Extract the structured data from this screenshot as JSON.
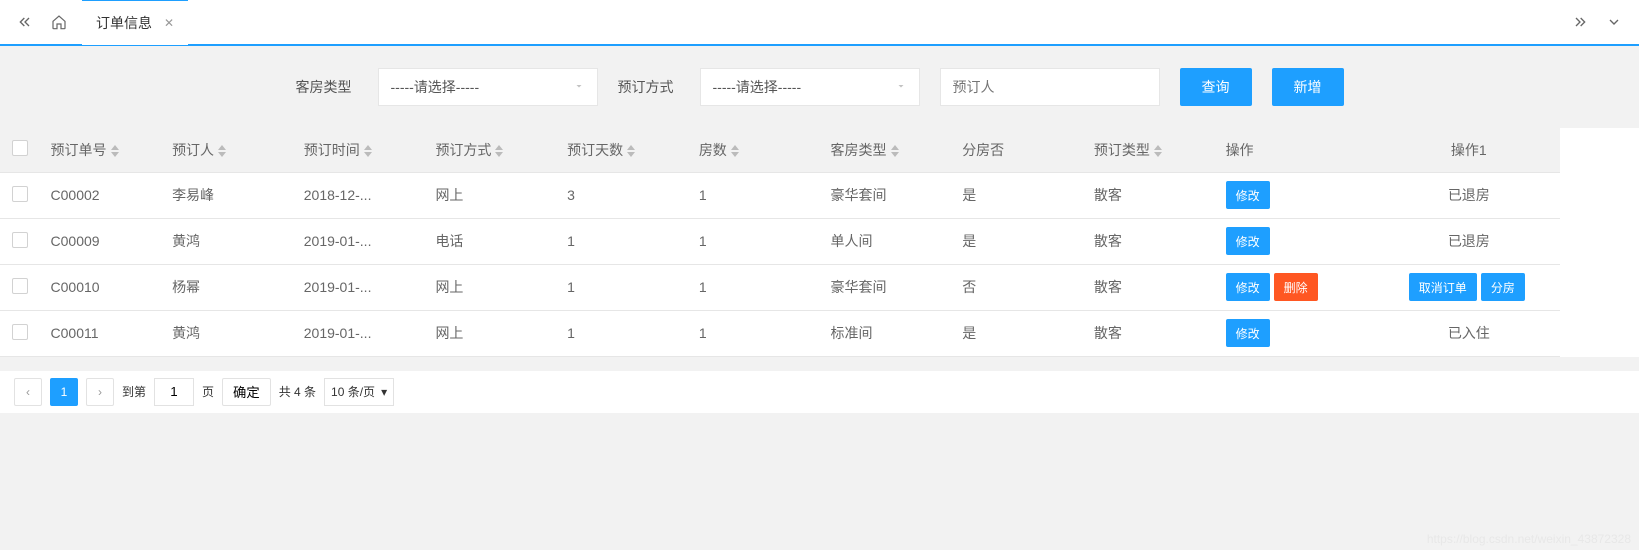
{
  "tab": {
    "title": "订单信息"
  },
  "filters": {
    "room_type_label": "客房类型",
    "room_type_placeholder": "-----请选择-----",
    "method_label": "预订方式",
    "method_placeholder": "-----请选择-----",
    "booker_placeholder": "预订人",
    "query_btn": "查询",
    "add_btn": "新增"
  },
  "columns": {
    "order_no": "预订单号",
    "booker": "预订人",
    "time": "预订时间",
    "method": "预订方式",
    "days": "预订天数",
    "rooms": "房数",
    "room_type": "客房类型",
    "assigned": "分房否",
    "booking_type": "预订类型",
    "action": "操作",
    "action1": "操作1"
  },
  "rows": [
    {
      "order_no": "C00002",
      "booker": "李易峰",
      "time": "2018-12-...",
      "method": "网上",
      "days": "3",
      "rooms": "1",
      "room_type": "豪华套间",
      "assigned": "是",
      "booking_type": "散客",
      "actions": [
        "edit"
      ],
      "status": "已退房",
      "status_buttons": []
    },
    {
      "order_no": "C00009",
      "booker": "黄鸿",
      "time": "2019-01-...",
      "method": "电话",
      "days": "1",
      "rooms": "1",
      "room_type": "单人间",
      "assigned": "是",
      "booking_type": "散客",
      "actions": [
        "edit"
      ],
      "status": "已退房",
      "status_buttons": []
    },
    {
      "order_no": "C00010",
      "booker": "杨幂",
      "time": "2019-01-...",
      "method": "网上",
      "days": "1",
      "rooms": "1",
      "room_type": "豪华套间",
      "assigned": "否",
      "booking_type": "散客",
      "actions": [
        "edit",
        "delete"
      ],
      "status": "",
      "status_buttons": [
        "cancel",
        "assign"
      ]
    },
    {
      "order_no": "C00011",
      "booker": "黄鸿",
      "time": "2019-01-...",
      "method": "网上",
      "days": "1",
      "rooms": "1",
      "room_type": "标准间",
      "assigned": "是",
      "booking_type": "散客",
      "actions": [
        "edit"
      ],
      "status": "已入住",
      "status_buttons": []
    }
  ],
  "actions": {
    "edit": "修改",
    "delete": "删除",
    "cancel": "取消订单",
    "assign": "分房"
  },
  "pagination": {
    "goto_label": "到第",
    "page_unit": "页",
    "confirm": "确定",
    "total_text": "共 4 条",
    "page_size": "10 条/页",
    "current_page": "1"
  },
  "watermark": "https://blog.csdn.net/weixin_43872328"
}
